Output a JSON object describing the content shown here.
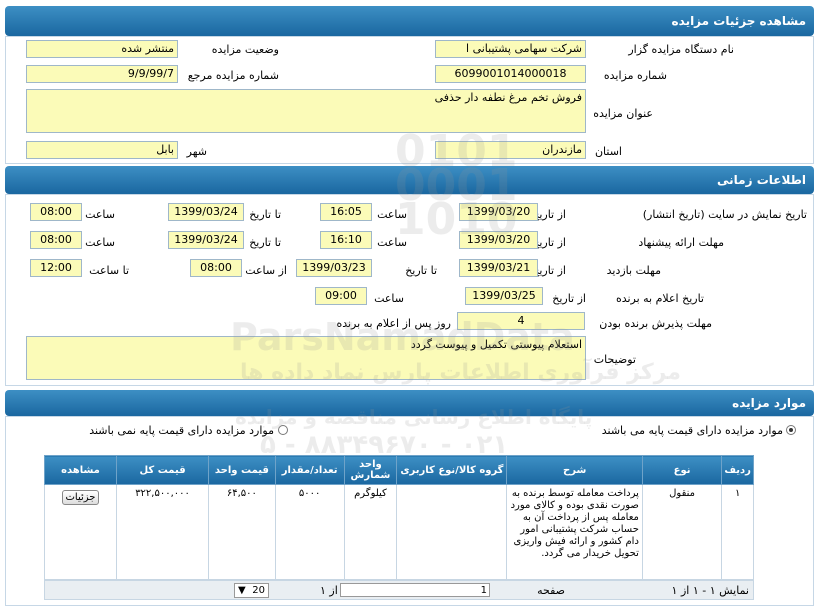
{
  "details": {
    "title": "مشاهده جزئیات مزایده",
    "org_label": "نام دستگاه مزایده گزار",
    "org_value": "شرکت سهامی پشتیبانی ا",
    "status_label": "وضعیت مزایده",
    "status_value": "منتشر شده",
    "number_label": "شماره مزایده",
    "number_value": "6099001014000018",
    "ref_label": "شماره مزایده مرجع",
    "ref_value": "9/9/99/7",
    "subject_label": "عنوان مزایده",
    "subject_value": "فروش تخم مرغ نطفه دار حذفی",
    "province_label": "استان",
    "province_value": "مازندران",
    "city_label": "شهر",
    "city_value": "بابل"
  },
  "timing": {
    "title": "اطلاعات زمانی",
    "row1": {
      "label": "تاریخ نمایش در سایت (تاریخ انتشار)",
      "from_label": "از تاریخ",
      "from_date": "1399/03/20",
      "time1_label": "ساعت",
      "time1": "16:05",
      "to_label": "تا تاریخ",
      "to_date": "1399/03/24",
      "time2_label": "ساعت",
      "time2": "08:00"
    },
    "row2": {
      "label": "مهلت ارائه پیشنهاد",
      "from_label": "از تاریخ",
      "from_date": "1399/03/20",
      "time1_label": "ساعت",
      "time1": "16:10",
      "to_label": "تا تاریخ",
      "to_date": "1399/03/24",
      "time2_label": "ساعت",
      "time2": "08:00"
    },
    "row3": {
      "label": "مهلت بازدید",
      "from_label": "از تاریخ",
      "from_date": "1399/03/21",
      "to_label": "تا تاریخ",
      "to_date": "1399/03/23",
      "from_time_label": "از ساعت",
      "from_time": "08:00",
      "to_time_label": "تا ساعت",
      "to_time": "12:00"
    },
    "row4": {
      "label": "تاریخ اعلام به برنده",
      "from_label": "از تاریخ",
      "date": "1399/03/25",
      "time_label": "ساعت",
      "time": "09:00"
    },
    "row5": {
      "label": "مهلت پذیرش برنده بودن",
      "value": "4",
      "suffix": "روز پس از اعلام به برنده"
    },
    "notes_label": "توضیحات",
    "notes_value": "استعلام پیوستی تکمیل و پیوست گردد"
  },
  "items": {
    "title": "موارد مزایده",
    "radio_with_base": "موارد مزایده دارای قیمت پایه می باشند",
    "radio_without_base": "موارد مزایده دارای قیمت پایه نمی باشند",
    "columns": [
      "ردیف",
      "نوع",
      "شرح",
      "گروه کالا/نوع کاربری",
      "واحد شمارش",
      "تعداد/مقدار",
      "قیمت واحد",
      "قیمت کل",
      "مشاهده"
    ],
    "rows": [
      {
        "index": "۱",
        "type": "منقول",
        "description": "پرداخت معامله توسط برنده به صورت نقدی بوده و کالای مورد معامله پس از پرداخت آن به حساب شرکت پشتیبانی امور دام کشور و ارائه فیش واریزی تحویل خریدار می گردد.",
        "group": "",
        "unit": "کیلوگرم",
        "quantity": "۵۰۰۰",
        "unit_price": "۶۴,۵۰۰",
        "total_price": "۳۲۲,۵۰۰,۰۰۰",
        "view_label": "جزئیات"
      }
    ],
    "pager": {
      "summary": "نمایش ۱ - ۱ از ۱",
      "page_label": "صفحه",
      "page_value": "1",
      "of_label": "از ۱",
      "page_size": "20"
    }
  },
  "watermark": {
    "digits": "0101 0001 1010",
    "brand": "ParsNamadData",
    "line1": "مرکز فرآوری اطلاعات پارس نماد داده ها",
    "line2": "پایگاه اطلاع رسانی مناقصه و مزایده",
    "phone": "۰۲۱ - ۸۸۳۴۹۶۷۰ - ۵"
  },
  "colors": {
    "header": "#2a78b0",
    "field": "#fbfbb8",
    "border": "#9fb7c9"
  }
}
